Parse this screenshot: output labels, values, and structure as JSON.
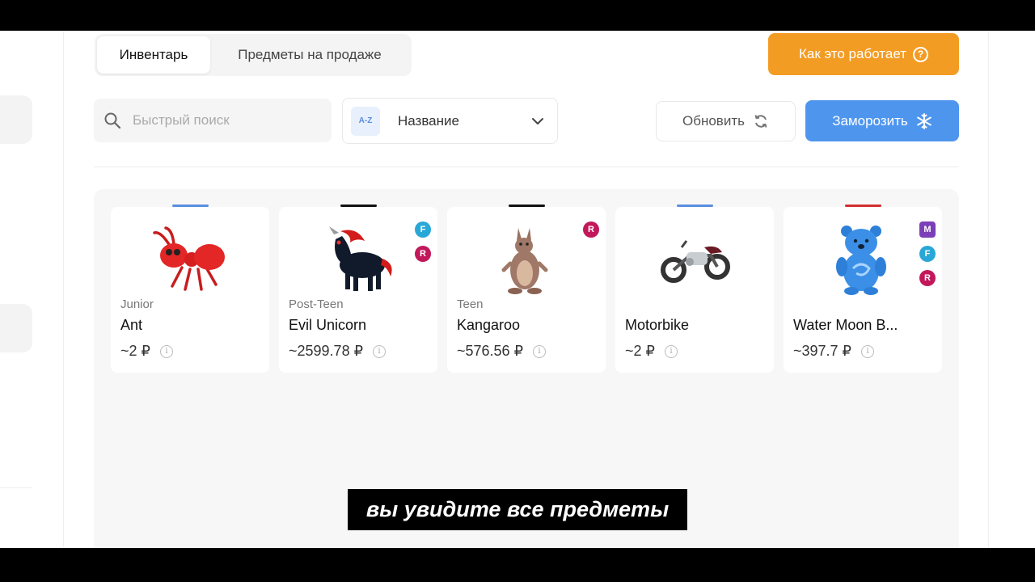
{
  "tabs": [
    {
      "label": "Инвентарь",
      "active": true
    },
    {
      "label": "Предметы на продаже",
      "active": false
    }
  ],
  "how_it_works": {
    "label": "Как это работает",
    "icon": "question-circle-icon",
    "color": "#f39c23"
  },
  "search": {
    "placeholder": "Быстрый поиск",
    "icon": "search-icon"
  },
  "sort": {
    "badge": "A-Z",
    "selected": "Название",
    "icon": "chevron-down-icon"
  },
  "refresh": {
    "label": "Обновить",
    "icon": "refresh-icon"
  },
  "freeze": {
    "label": "Заморозить",
    "icon": "snowflake-icon",
    "color": "#4e95ee"
  },
  "items": [
    {
      "age": "Junior",
      "name": "Ant",
      "price": "~2 ₽",
      "rarity_color": "#5a8ee0",
      "badges": [],
      "icon": "red-ant-icon"
    },
    {
      "age": "Post-Teen",
      "name": "Evil Unicorn",
      "price": "~2599.78 ₽",
      "rarity_color": "#111111",
      "badges": [
        {
          "letter": "F",
          "color": "#29a8d8"
        },
        {
          "letter": "R",
          "color": "#c2185b"
        }
      ],
      "icon": "black-unicorn-icon"
    },
    {
      "age": "Teen",
      "name": "Kangaroo",
      "price": "~576.56 ₽",
      "rarity_color": "#111111",
      "badges": [
        {
          "letter": "R",
          "color": "#c2185b"
        }
      ],
      "icon": "kangaroo-icon"
    },
    {
      "age": "",
      "name": "Motorbike",
      "price": "~2 ₽",
      "rarity_color": "#5a8ee0",
      "badges": [],
      "icon": "motorbike-icon"
    },
    {
      "age": "",
      "name": "Water Moon B...",
      "price": "~397.7 ₽",
      "rarity_color": "#d32f2f",
      "badges": [
        {
          "letter": "M",
          "color": "#7b3fb8"
        },
        {
          "letter": "F",
          "color": "#29a8d8"
        },
        {
          "letter": "R",
          "color": "#c2185b"
        }
      ],
      "icon": "blue-bear-icon"
    }
  ],
  "subtitle": "вы увидите все предметы"
}
